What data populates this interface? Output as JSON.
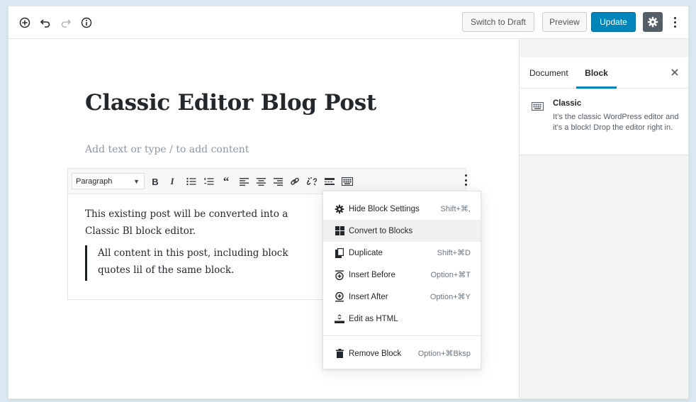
{
  "colors": {
    "accent": "#0085ba",
    "background": "#dbeaf2",
    "menu_active": "#f0f0f0"
  },
  "topbar": {
    "icons": [
      "add-block-icon",
      "undo-icon",
      "redo-icon",
      "info-icon",
      "gear-icon",
      "more-options-icon"
    ],
    "switch_to_draft": "Switch to Draft",
    "preview": "Preview",
    "update": "Update"
  },
  "editor": {
    "title": "Classic Editor Blog Post",
    "placeholder": "Add text or type / to add content",
    "classic_block": {
      "format_select": "Paragraph",
      "toolbar_icons": [
        "bold-icon",
        "italic-icon",
        "bulleted-list-icon",
        "numbered-list-icon",
        "blockquote-icon",
        "align-left-icon",
        "align-center-icon",
        "align-right-icon",
        "link-icon",
        "unlink-icon",
        "read-more-icon",
        "toolbar-toggle-icon"
      ],
      "paragraph": "This existing post will be converted into a Classic Bl block editor.",
      "quote": "All content in this post, including block quotes lil of the same block."
    }
  },
  "block_menu": {
    "items": [
      {
        "label": "Hide Block Settings",
        "shortcut": "Shift+⌘,",
        "icon": "gear-icon"
      },
      {
        "label": "Convert to Blocks",
        "shortcut": "",
        "icon": "grid-icon"
      },
      {
        "label": "Duplicate",
        "shortcut": "Shift+⌘D",
        "icon": "duplicate-icon"
      },
      {
        "label": "Insert Before",
        "shortcut": "Option+⌘T",
        "icon": "insert-before-icon"
      },
      {
        "label": "Insert After",
        "shortcut": "Option+⌘Y",
        "icon": "insert-after-icon"
      },
      {
        "label": "Edit as HTML",
        "shortcut": "",
        "icon": "html-icon"
      },
      {
        "label": "Remove Block",
        "shortcut": "Option+⌘Bksp",
        "icon": "trash-icon"
      }
    ],
    "active_item": "Convert to Blocks"
  },
  "sidebar": {
    "tabs": [
      "Document",
      "Block"
    ],
    "active_tab": "Block",
    "block_card": {
      "title": "Classic",
      "description": "It’s the classic WordPress editor and it’s a block! Drop the editor right in."
    }
  }
}
